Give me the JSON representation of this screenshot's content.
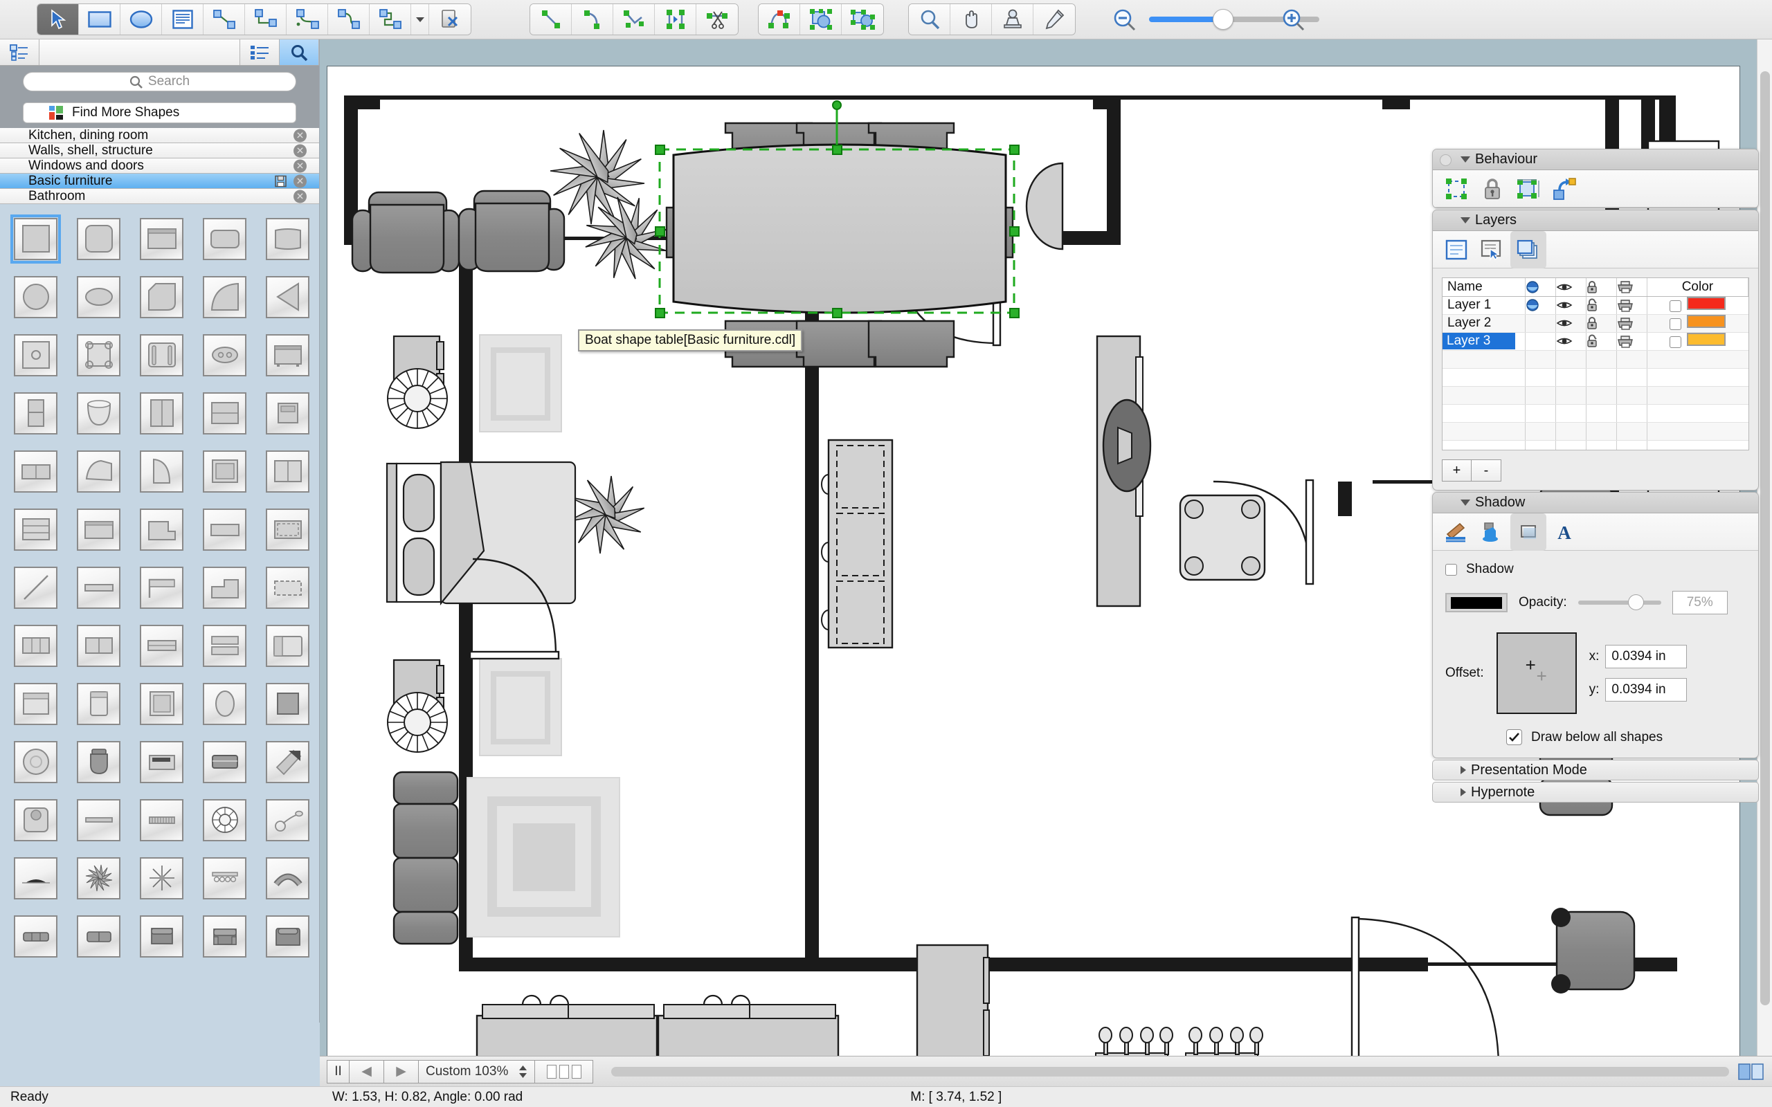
{
  "app": {
    "title": "Floor plan editor"
  },
  "toolbar": {
    "groups": [
      {
        "name": "tools",
        "buttons": [
          {
            "icon": "pointer-icon",
            "label": "Select",
            "active": true
          },
          {
            "icon": "rectangle-icon",
            "label": "Rectangle"
          },
          {
            "icon": "ellipse-icon",
            "label": "Ellipse"
          },
          {
            "icon": "text-block-icon",
            "label": "Text"
          },
          {
            "icon": "line-connector-icon",
            "label": "Straight connector"
          },
          {
            "icon": "curve-connector-icon",
            "label": "Curved connector"
          },
          {
            "icon": "tree-connector-icon",
            "label": "Tree connector"
          },
          {
            "icon": "arc-connector-icon",
            "label": "Arc connector"
          },
          {
            "icon": "ortho-connector-icon",
            "label": "Orthogonal connector"
          },
          {
            "icon": "chevron-down-icon",
            "label": "More connectors"
          },
          {
            "icon": "delete-shape-icon",
            "label": "Delete shape"
          }
        ]
      },
      {
        "name": "geometry",
        "buttons": [
          {
            "icon": "segment-line-icon",
            "label": "Line segment"
          },
          {
            "icon": "segment-arc-icon",
            "label": "Arc segment"
          },
          {
            "icon": "polyline-icon",
            "label": "Polyline"
          },
          {
            "icon": "split-node-icon",
            "label": "Split node"
          },
          {
            "icon": "cut-path-icon",
            "label": "Cut path"
          }
        ]
      },
      {
        "name": "shape-ops",
        "buttons": [
          {
            "icon": "edit-path-icon",
            "label": "Edit path"
          },
          {
            "icon": "union-shapes-icon",
            "label": "Union"
          },
          {
            "icon": "group-shapes-icon",
            "label": "Group"
          }
        ]
      },
      {
        "name": "view-tools",
        "buttons": [
          {
            "icon": "magnifier-icon",
            "label": "Zoom"
          },
          {
            "icon": "hand-icon",
            "label": "Pan"
          },
          {
            "icon": "stamp-icon",
            "label": "Stamp"
          },
          {
            "icon": "pencil-icon",
            "label": "Pencil"
          }
        ]
      }
    ],
    "zoom_slider": {
      "minus": "zoom-out-icon",
      "plus": "zoom-in-icon",
      "value": 38
    }
  },
  "sidebar": {
    "tabs": [
      {
        "icon": "tree-view-icon",
        "label": "Document tree",
        "selected": false
      },
      {
        "icon": "list-view-icon",
        "label": "Library list",
        "selected": false
      },
      {
        "icon": "search-icon",
        "label": "Search shapes",
        "selected": true
      }
    ],
    "search": {
      "placeholder": "Search",
      "value": "",
      "icon": "search-icon"
    },
    "find_more": {
      "label": "Find More Shapes",
      "icon": "shapes-store-icon"
    },
    "categories": [
      {
        "label": "Kitchen, dining room",
        "selected": false,
        "has_save": false
      },
      {
        "label": "Walls, shell, structure",
        "selected": false,
        "has_save": false
      },
      {
        "label": "Windows and doors",
        "selected": false,
        "has_save": false
      },
      {
        "label": "Basic furniture",
        "selected": true,
        "has_save": true
      },
      {
        "label": "Bathroom",
        "selected": false,
        "has_save": false
      }
    ],
    "shapes": [
      {
        "name": "square-table",
        "selected": true
      },
      {
        "name": "rounded-square-table",
        "selected": false
      },
      {
        "name": "desk-with-back",
        "selected": false
      },
      {
        "name": "rounded-desk",
        "selected": false
      },
      {
        "name": "barrel-table",
        "selected": false
      },
      {
        "name": "round-table",
        "selected": false
      },
      {
        "name": "oval-table",
        "selected": false
      },
      {
        "name": "cut-corner-table",
        "selected": false
      },
      {
        "name": "quarter-round-table",
        "selected": false
      },
      {
        "name": "wedge-table",
        "selected": false
      },
      {
        "name": "table-with-knob",
        "selected": false
      },
      {
        "name": "table-four-legs",
        "selected": false
      },
      {
        "name": "bench-two-rails",
        "selected": false
      },
      {
        "name": "oval-stool-two-holes",
        "selected": false
      },
      {
        "name": "cabinet-with-legs",
        "selected": false
      },
      {
        "name": "tall-cabinet",
        "selected": false
      },
      {
        "name": "bathtub",
        "selected": false
      },
      {
        "name": "wardrobe",
        "selected": false
      },
      {
        "name": "dresser",
        "selected": false
      },
      {
        "name": "nightstand",
        "selected": false
      },
      {
        "name": "low-cabinet",
        "selected": false
      },
      {
        "name": "folded-cloth",
        "selected": false
      },
      {
        "name": "door-leaf",
        "selected": false
      },
      {
        "name": "box-shelf",
        "selected": false
      },
      {
        "name": "double-box-shelf",
        "selected": false
      },
      {
        "name": "shelf-unit",
        "selected": false
      },
      {
        "name": "counter-unit",
        "selected": false
      },
      {
        "name": "corner-counter",
        "selected": false
      },
      {
        "name": "wide-counter",
        "selected": false
      },
      {
        "name": "dashed-counter",
        "selected": false
      },
      {
        "name": "diagonal-panel",
        "selected": false
      },
      {
        "name": "flat-panel",
        "selected": false
      },
      {
        "name": "angled-shelf",
        "selected": false
      },
      {
        "name": "step-unit",
        "selected": false
      },
      {
        "name": "dashed-panel",
        "selected": false
      },
      {
        "name": "grid-bench",
        "selected": false
      },
      {
        "name": "split-bench",
        "selected": false
      },
      {
        "name": "long-bench",
        "selected": false
      },
      {
        "name": "stacked-bench",
        "selected": false
      },
      {
        "name": "wide-bed",
        "selected": false
      },
      {
        "name": "bed-frame",
        "selected": false
      },
      {
        "name": "single-bed",
        "selected": false
      },
      {
        "name": "bed-square",
        "selected": false
      },
      {
        "name": "oval-bed",
        "selected": false
      },
      {
        "name": "square-pouf",
        "selected": false
      },
      {
        "name": "round-rug",
        "selected": false
      },
      {
        "name": "armchair-top",
        "selected": false
      },
      {
        "name": "sideboard",
        "selected": false
      },
      {
        "name": "mattress",
        "selected": false
      },
      {
        "name": "diagonal-board",
        "selected": false
      },
      {
        "name": "sink-unit",
        "selected": false
      },
      {
        "name": "thin-bench",
        "selected": false
      },
      {
        "name": "radiator",
        "selected": false
      },
      {
        "name": "ceiling-fan",
        "selected": false
      },
      {
        "name": "floor-lamp",
        "selected": false
      },
      {
        "name": "sideboard-low",
        "selected": false
      },
      {
        "name": "plant-star",
        "selected": false
      },
      {
        "name": "plant-small-star",
        "selected": false
      },
      {
        "name": "coat-rack",
        "selected": false
      },
      {
        "name": "curved-sofa",
        "selected": false
      },
      {
        "name": "three-seat-sofa",
        "selected": false
      },
      {
        "name": "two-seat-sofa",
        "selected": false
      },
      {
        "name": "armchair-a",
        "selected": false
      },
      {
        "name": "armchair-b",
        "selected": false
      },
      {
        "name": "armchair-c",
        "selected": false
      }
    ]
  },
  "canvas": {
    "zoom_label": "Custom 103%",
    "tooltip": "Boat shape table[Basic furniture.cdl]",
    "selection": {
      "shape": "Boat shape table",
      "handles": 8,
      "rotation_handle": true
    },
    "nav": {
      "pause": "II",
      "prev": "◀",
      "next": "▶",
      "page_buttons": 3
    }
  },
  "inspector": {
    "behaviour": {
      "title": "Behaviour",
      "icons": [
        {
          "name": "selectable-icon",
          "label": "Selectable"
        },
        {
          "name": "lock-icon",
          "label": "Locked"
        },
        {
          "name": "resizable-icon",
          "label": "Resizable"
        },
        {
          "name": "connectable-icon",
          "label": "Connectable"
        }
      ]
    },
    "layers": {
      "title": "Layers",
      "icons": [
        {
          "name": "layer-list-icon",
          "label": "Layer list",
          "active": false
        },
        {
          "name": "layer-select-icon",
          "label": "Select layer",
          "active": false
        },
        {
          "name": "layer-stack-icon",
          "label": "Layer stack",
          "active": true
        }
      ],
      "columns": [
        {
          "key": "name",
          "label": "Name"
        },
        {
          "key": "active",
          "label": "",
          "icon": "active-layer-icon"
        },
        {
          "key": "visible",
          "label": "",
          "icon": "eye-icon"
        },
        {
          "key": "locked",
          "label": "",
          "icon": "lock-icon"
        },
        {
          "key": "printable",
          "label": "",
          "icon": "printer-icon"
        },
        {
          "key": "color",
          "label": "Color"
        }
      ],
      "rows": [
        {
          "name": "Layer 1",
          "active": true,
          "visible": true,
          "locked": false,
          "printable": true,
          "color_checked": false,
          "color": "#f42a1c",
          "selected": false
        },
        {
          "name": "Layer 2",
          "active": false,
          "visible": true,
          "locked": true,
          "printable": true,
          "color_checked": false,
          "color": "#f7921e",
          "selected": false
        },
        {
          "name": "Layer 3",
          "active": false,
          "visible": true,
          "locked": false,
          "printable": true,
          "color_checked": false,
          "color": "#fcbb2e",
          "selected": true
        }
      ],
      "add_label": "+",
      "remove_label": "-"
    },
    "shadow": {
      "title": "Shadow",
      "tabs": [
        {
          "name": "stroke-icon",
          "label": "Stroke",
          "active": false
        },
        {
          "name": "fill-icon",
          "label": "Fill",
          "active": false
        },
        {
          "name": "shadow-icon",
          "label": "Shadow",
          "active": true
        },
        {
          "name": "text-icon",
          "label": "Text",
          "active": false
        }
      ],
      "enabled_label": "Shadow",
      "enabled": false,
      "color": "#000000",
      "opacity_label": "Opacity:",
      "opacity_value": "75%",
      "opacity_pct": 68,
      "offset_label": "Offset:",
      "x_label": "x:",
      "x_value": "0.0394 in",
      "y_label": "y:",
      "y_value": "0.0394 in",
      "draw_below_label": "Draw below all shapes",
      "draw_below": true
    },
    "presentation_mode": {
      "title": "Presentation Mode",
      "expanded": false
    },
    "hypernote": {
      "title": "Hypernote",
      "expanded": false
    }
  },
  "statusbar": {
    "ready": "Ready",
    "dimensions": "W: 1.53,  H: 0.82,  Angle: 0.00 rad",
    "mouse": "M: [ 3.74, 1.52 ]"
  },
  "colors": {
    "accent": "#1e73d8",
    "canvas_bg": "#a9bec7",
    "sidebar_bg": "#c6d6e3",
    "selection_green": "#2bb02b",
    "tooltip_bg": "#fbfbdc"
  }
}
